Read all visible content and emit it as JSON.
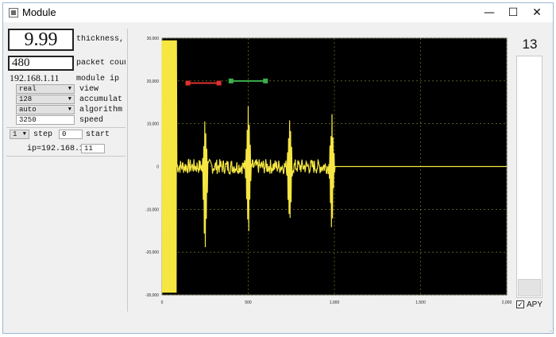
{
  "window": {
    "title": "Module",
    "minimize": "—",
    "maximize": "☐",
    "close": "✕"
  },
  "left_panel": {
    "thickness_value": "9.99",
    "thickness_label": "thickness, mm",
    "packet_value": "480",
    "packet_label": "packet counter",
    "module_ip_value": "192.168.1.11",
    "module_ip_label": "module ip",
    "view": {
      "value": "real",
      "label": "view"
    },
    "accumulate": {
      "value": "128",
      "label": "accumulat"
    },
    "algorithm": {
      "value": "auto",
      "label": "algorithm"
    },
    "speed": {
      "value": "3250",
      "label": "speed"
    },
    "step": {
      "value": "1",
      "label": "step"
    },
    "start": {
      "value": "0",
      "label": "start"
    },
    "ip_prefix": "ip=192.168.1.",
    "ip_suffix": "11"
  },
  "right_panel": {
    "counter": "13",
    "apy_label": "APY",
    "apy_checked": "✓"
  },
  "chart_data": {
    "type": "line",
    "title": "",
    "xlabel": "",
    "ylabel": "",
    "xlim": [
      0,
      2000
    ],
    "ylim": [
      -30000,
      30000
    ],
    "x_ticks": [
      0,
      500,
      1000,
      1500,
      2000
    ],
    "x_tick_labels": [
      "0",
      "500",
      "1,000",
      "1,500",
      "2,000"
    ],
    "y_ticks": [
      30000,
      20000,
      10000,
      0,
      -10000,
      -20000,
      -30000
    ],
    "y_tick_labels": [
      "30,000",
      "20,000",
      "10,000",
      "0",
      "-10,000",
      "-20,000",
      "-30,000"
    ],
    "grid": true,
    "background": "#000000",
    "line_color": "#f5e642",
    "pulses": [
      {
        "x": 250,
        "peak": 12000,
        "trough": -24000
      },
      {
        "x": 500,
        "peak": 17000,
        "trough": -21000
      },
      {
        "x": 740,
        "peak": 14000,
        "trough": -17000
      },
      {
        "x": 985,
        "peak": 14000,
        "trough": -16000
      }
    ],
    "markers": [
      {
        "name": "red",
        "x_start": 150,
        "x_end": 330,
        "y": 19500,
        "color": "#e03030"
      },
      {
        "name": "green",
        "x_start": 400,
        "x_end": 600,
        "y": 20000,
        "color": "#3bb04a"
      }
    ]
  }
}
